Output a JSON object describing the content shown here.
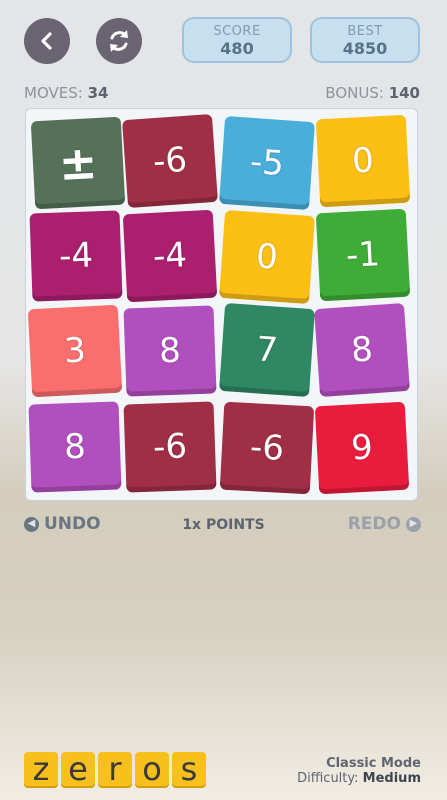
{
  "header": {
    "back_icon": "back-arrow-icon",
    "restart_icon": "restart-icon",
    "score_label": "SCORE",
    "score_value": "480",
    "best_label": "BEST",
    "best_value": "4850"
  },
  "stats": {
    "moves_label": "MOVES:",
    "moves_value": "34",
    "bonus_label": "BONUS:",
    "bonus_value": "140"
  },
  "board": {
    "tiles": [
      {
        "text": "±",
        "color": "#557258"
      },
      {
        "text": "-6",
        "color": "#a02f45"
      },
      {
        "text": "-5",
        "color": "#4aaedb"
      },
      {
        "text": "0",
        "color": "#fbbf16"
      },
      {
        "text": "-4",
        "color": "#ab1f6f"
      },
      {
        "text": "-4",
        "color": "#ab1f6f"
      },
      {
        "text": "0",
        "color": "#fbbf16"
      },
      {
        "text": "-1",
        "color": "#3fac37"
      },
      {
        "text": "3",
        "color": "#fb6e6e"
      },
      {
        "text": "8",
        "color": "#b24fbf"
      },
      {
        "text": "7",
        "color": "#2f8763"
      },
      {
        "text": "8",
        "color": "#b24fbf"
      },
      {
        "text": "8",
        "color": "#b24fbf"
      },
      {
        "text": "-6",
        "color": "#a02f45"
      },
      {
        "text": "-6",
        "color": "#a02f45"
      },
      {
        "text": "9",
        "color": "#ea1c3e"
      }
    ]
  },
  "actions": {
    "undo_label": "UNDO",
    "points_label": "1x POINTS",
    "redo_label": "REDO"
  },
  "footer": {
    "logo_letters": [
      "z",
      "e",
      "r",
      "o",
      "s"
    ],
    "mode_label": "Classic Mode",
    "difficulty_label": "Difficulty:",
    "difficulty_value": "Medium"
  }
}
